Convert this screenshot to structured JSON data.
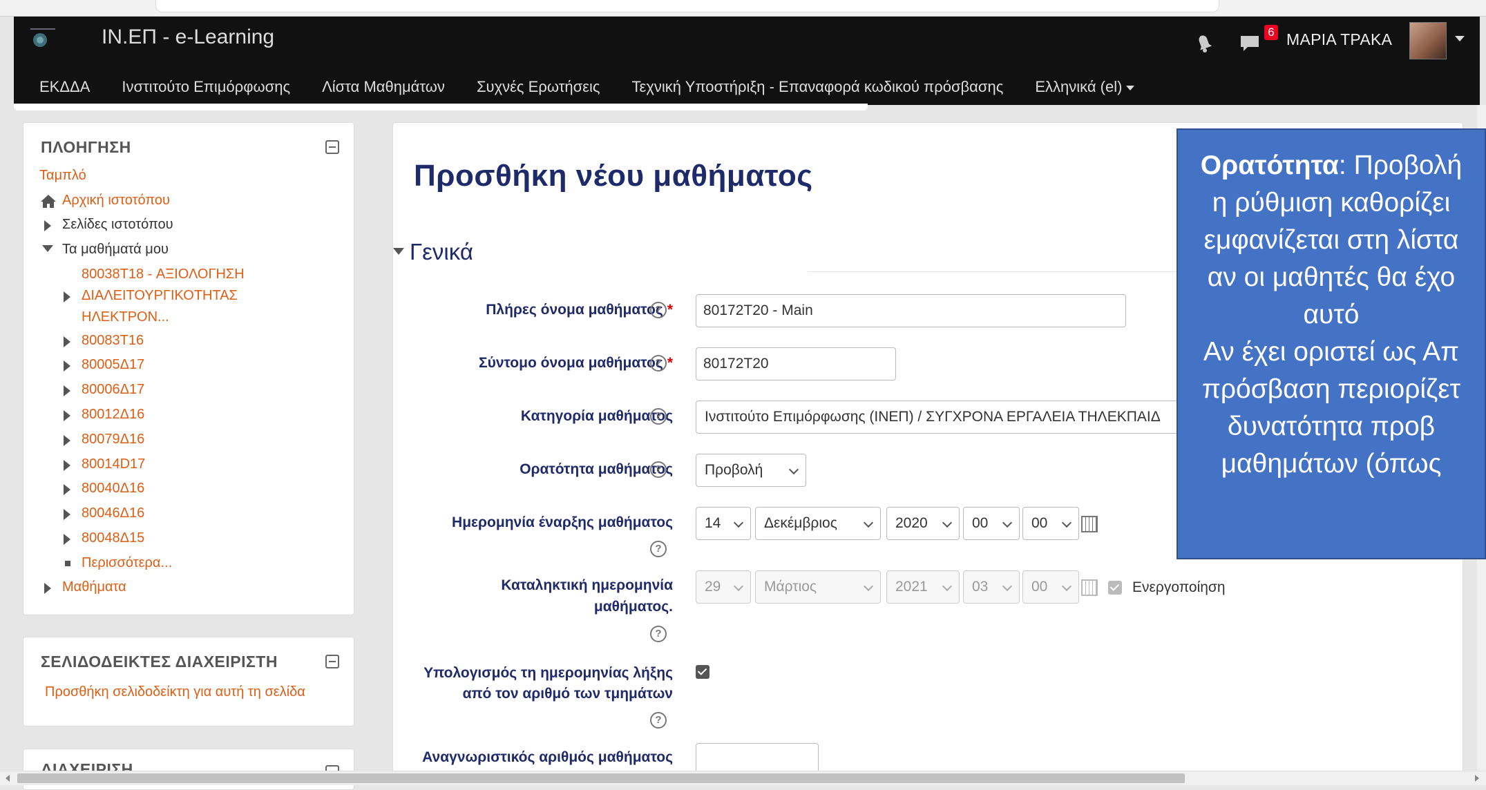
{
  "navbar": {
    "brand": "ΙΝ.ΕΠ - e-Learning",
    "messages_count": "6",
    "user_name": "ΜΑΡΙΑ ΤΡΑΚΑ",
    "menu": [
      {
        "label": "ΕΚΔΔΑ"
      },
      {
        "label": "Ινστιτούτο Επιμόρφωσης"
      },
      {
        "label": "Λίστα Μαθημάτων"
      },
      {
        "label": "Συχνές Ερωτήσεις"
      },
      {
        "label": "Τεχνική Υποστήριξη - Επαναφορά κωδικού πρόσβασης"
      },
      {
        "label": "Ελληνικά (el)"
      }
    ]
  },
  "nav_block": {
    "title": "ΠΛΟΗΓΗΣΗ",
    "dashboard": "Ταμπλό",
    "home": "Αρχική ιστοτόπου",
    "site_pages": "Σελίδες ιστοτόπου",
    "my_courses": "Τα μαθήματά μου",
    "courses": [
      "80038T18 - ΑΞΙΟΛΟΓΗΣΗ",
      "ΔΙΑΛΕΙΤΟΥΡΓΙΚΟΤΗΤΑΣ",
      "ΗΛΕΚΤΡΟΝ...",
      "80083Τ16",
      "80005Δ17",
      "80006Δ17",
      "80012Δ16",
      "80079Δ16",
      "80014D17",
      "80040Δ16",
      "80046Δ16",
      "80048Δ15",
      "Περισσότερα..."
    ],
    "courses_root": "Μαθήματα"
  },
  "bookmarks_block": {
    "title": "ΣΕΛΙΔΟΔΕΙΚΤΕΣ ΔΙΑΧΕΙΡΙΣΤΗ",
    "link": "Προσθήκη σελιδοδείκτη για αυτή τη σελίδα"
  },
  "admin_block": {
    "title": "ΔΙΑΧΕΙΡΙΣΗ"
  },
  "form": {
    "page_title": "Προσθήκη νέου μαθήματος",
    "section": "Γενικά",
    "fullname_label": "Πλήρες όνομα μαθήματος",
    "fullname_value": "80172T20 - Main",
    "shortname_label": "Σύντομο όνομα μαθήματος",
    "shortname_value": "80172T20",
    "category_label": "Κατηγορία μαθήματος",
    "category_value": "Ινστιτούτο Επιμόρφωσης (ΙΝΕΠ) / ΣΥΓΧΡΟΝΑ ΕΡΓΑΛΕΙΑ ΤΗΛΕΚΠΑΙΔ",
    "visibility_label": "Ορατότητα μαθήματος",
    "visibility_value": "Προβολή",
    "startdate_label": "Ημερομηνία έναρξης μαθήματος",
    "start_day": "14",
    "start_month": "Δεκέμβριος",
    "start_year": "2020",
    "start_hour": "00",
    "start_minute": "00",
    "enddate_label_1": "Καταληκτική ημερομηνία",
    "enddate_label_2": "μαθήματος.",
    "end_day": "29",
    "end_month": "Μάρτιος",
    "end_year": "2021",
    "end_hour": "03",
    "end_minute": "00",
    "enable_label": "Ενεργοποίηση",
    "calc_label_1": "Υπολογισμός τη ημερομηνίας λήξης",
    "calc_label_2": "από τον αριθμό των τμημάτων",
    "idnumber_label": "Αναγνωριστικός αριθμός μαθήματος",
    "help_glyph": "?"
  },
  "overlay": {
    "bold": "Ορατότητα",
    "lines": [
      ": Προβολή",
      "η ρύθμιση καθορίζει",
      "εμφανίζεται στη λίστα",
      "αν οι μαθητές θα έχο",
      "αυτό",
      "Αν έχει οριστεί ως Απ",
      "πρόσβαση περιορίζετ",
      "δυνατότητα προβ",
      "μαθημάτων (όπως"
    ],
    "color": "#4472c4"
  },
  "colors": {
    "navbar": "#111111",
    "link": "#e05e14",
    "heading": "#1e2a6a"
  }
}
